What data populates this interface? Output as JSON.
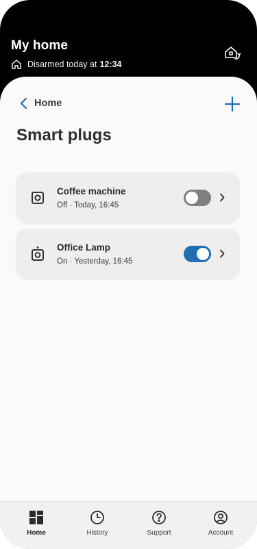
{
  "header": {
    "title": "My home",
    "status_text": "Disarmed today at",
    "status_time": "12:34"
  },
  "nav": {
    "back_label": "Home"
  },
  "page": {
    "title": "Smart plugs"
  },
  "plugs": [
    {
      "name": "Coffee machine",
      "status": "Off · Today, 16:45",
      "on": false
    },
    {
      "name": "Office Lamp",
      "status": "On · Yesterday, 16:45",
      "on": true
    }
  ],
  "tabs": [
    {
      "label": "Home",
      "icon": "dashboard-icon",
      "active": true
    },
    {
      "label": "History",
      "icon": "clock-icon",
      "active": false
    },
    {
      "label": "Support",
      "icon": "help-icon",
      "active": false
    },
    {
      "label": "Account",
      "icon": "account-icon",
      "active": false
    }
  ],
  "colors": {
    "header_bg": "#000000",
    "sheet_bg": "#fbfafa",
    "card_bg": "#efeded",
    "accent": "#1f6fb2",
    "toggle_off": "#7f7f7f"
  }
}
